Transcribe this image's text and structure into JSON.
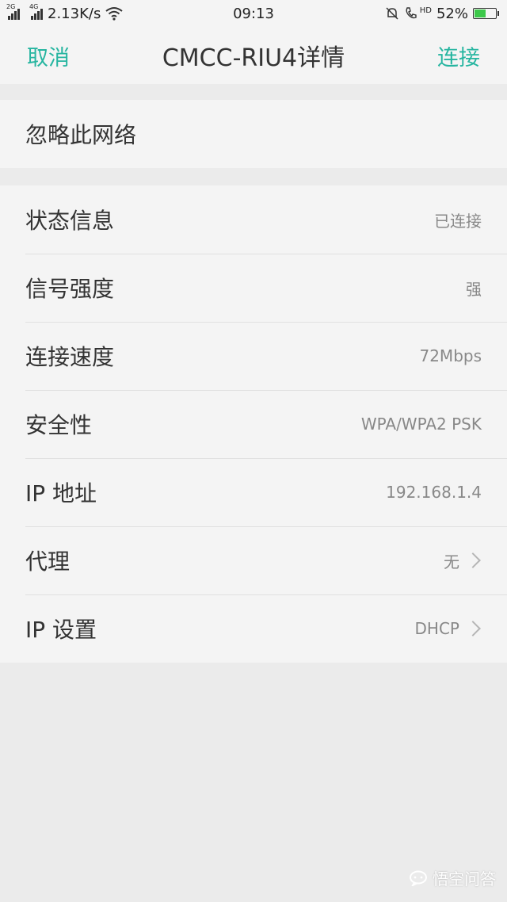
{
  "status_bar": {
    "net_tag_1": "2G",
    "net_tag_2": "4G",
    "speed": "2.13K/s",
    "time": "09:13",
    "hd": "HD",
    "battery": "52%",
    "battery_level": 0.52
  },
  "header": {
    "cancel_label": "取消",
    "title": "CMCC-RIU4详情",
    "connect_label": "连接"
  },
  "forget_label": "忽略此网络",
  "rows": [
    {
      "label": "状态信息",
      "value": "已连接"
    },
    {
      "label": "信号强度",
      "value": "强"
    },
    {
      "label": "连接速度",
      "value": "72Mbps"
    },
    {
      "label": "安全性",
      "value": "WPA/WPA2 PSK"
    },
    {
      "label": "IP 地址",
      "value": "192.168.1.4"
    },
    {
      "label": "代理",
      "value": "无"
    },
    {
      "label": "IP 设置",
      "value": "DHCP"
    }
  ],
  "watermark": "悟空问答",
  "colors": {
    "accent": "#26b5a0",
    "background": "#ebebeb",
    "panel": "#f4f4f4"
  }
}
